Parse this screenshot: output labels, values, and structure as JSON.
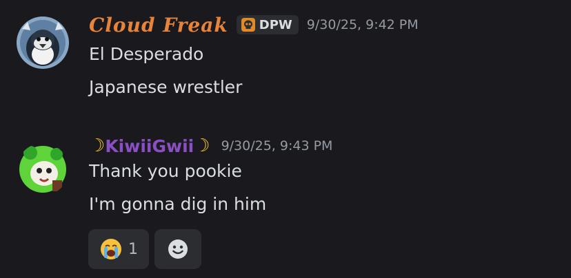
{
  "messages": [
    {
      "username": "Cloud Freak",
      "tag": "DPW",
      "timestamp": "9/30/25, 9:42 PM",
      "lines": [
        "El Desperado",
        "Japanese wrestler"
      ]
    },
    {
      "username": "KiwiiGwii",
      "timestamp": "9/30/25, 9:43 PM",
      "lines": [
        "Thank you pookie",
        "I'm gonna dig in him"
      ],
      "reactions": [
        {
          "emoji": "loudly-crying-face",
          "count": "1"
        },
        {
          "emoji": "add-reaction-icon"
        }
      ]
    }
  ],
  "colors": {
    "background": "#1a1a1e",
    "username1": "#e8843a",
    "username2": "#8b4fc4",
    "timestamp": "#949ba4",
    "text": "#dbdee1"
  }
}
